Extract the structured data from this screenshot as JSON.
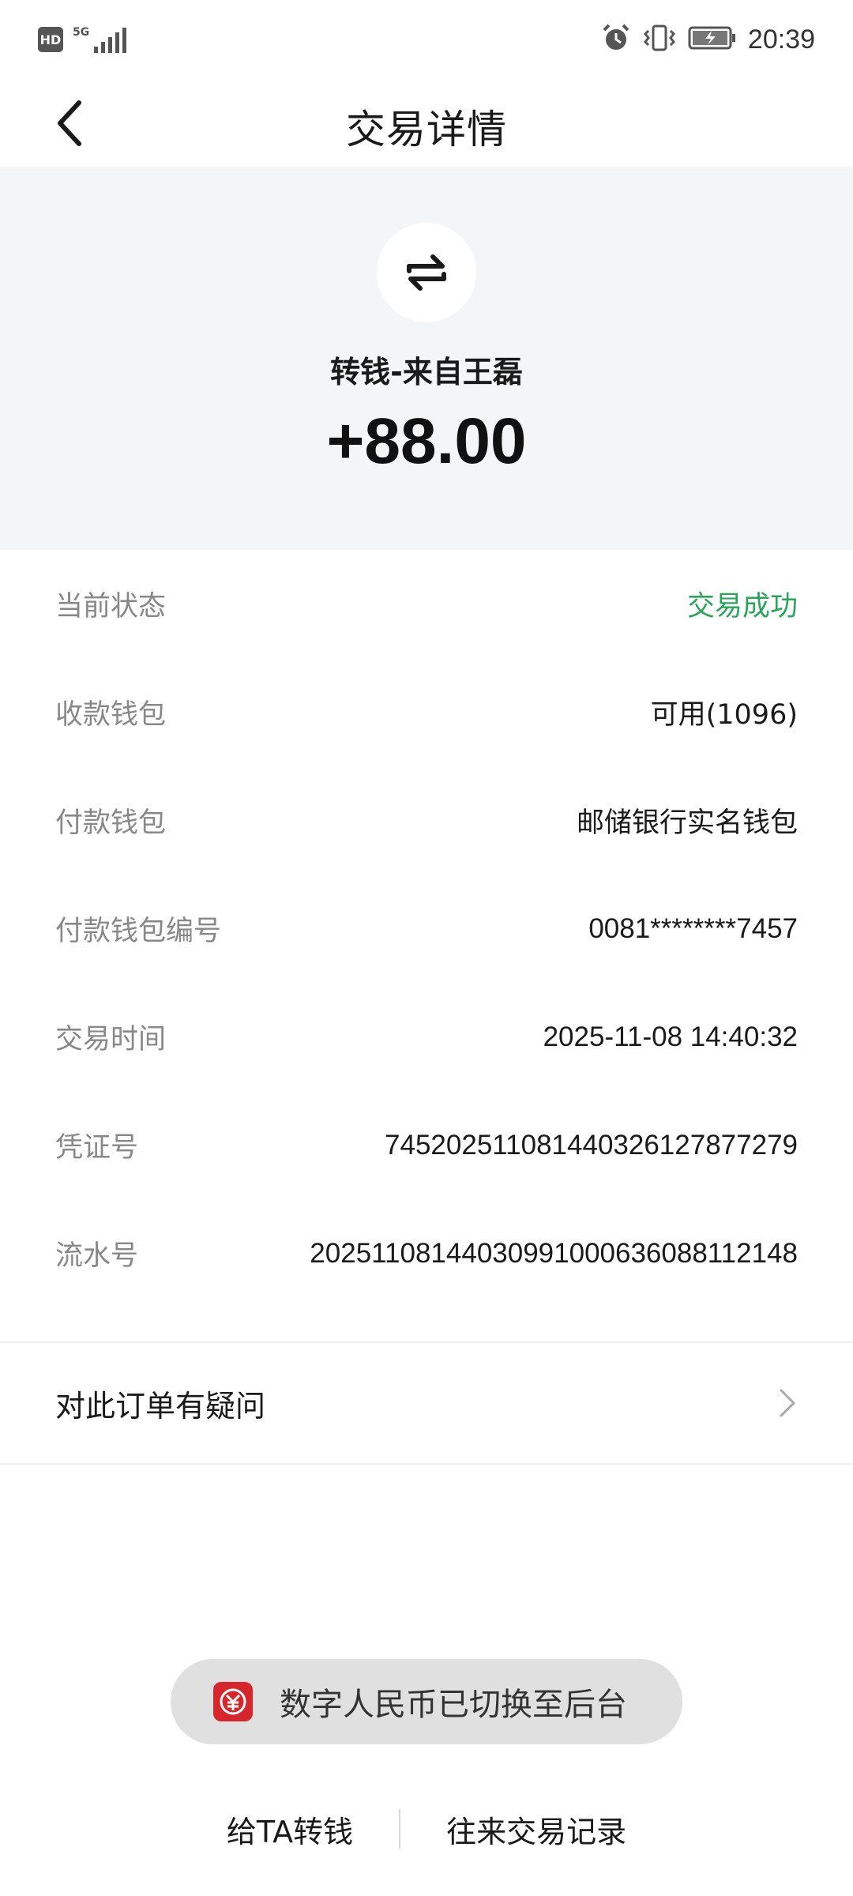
{
  "status_bar": {
    "hd_label": "HD",
    "network_label": "5G",
    "time": "20:39",
    "icons": [
      "alarm-icon",
      "vibrate-icon",
      "battery-icon"
    ]
  },
  "nav": {
    "title": "交易详情",
    "back_icon": "chevron-left-icon"
  },
  "header": {
    "icon": "transfer-arrows-icon",
    "title": "转钱-来自王磊",
    "amount": "+88.00"
  },
  "details": [
    {
      "label": "当前状态",
      "value": "交易成功",
      "status_color": "#2aa55a"
    },
    {
      "label": "收款钱包",
      "value": "可用(1096)"
    },
    {
      "label": "付款钱包",
      "value": "邮储银行实名钱包"
    },
    {
      "label": "付款钱包编号",
      "value": "0081********7457"
    },
    {
      "label": "交易时间",
      "value": "2025-11-08 14:40:32"
    },
    {
      "label": "凭证号",
      "value": "745202511081440326127877279"
    },
    {
      "label": "流水号",
      "value": "20251108144030991000636088112148"
    }
  ],
  "inquiry": {
    "label": "对此订单有疑问",
    "icon": "chevron-right-icon"
  },
  "toast": {
    "text": "数字人民币已切换至后台",
    "icon": "e-cny-logo-icon",
    "icon_color": "#d7262b"
  },
  "bottom_actions": {
    "transfer_label": "给TA转钱",
    "history_label": "往来交易记录"
  }
}
